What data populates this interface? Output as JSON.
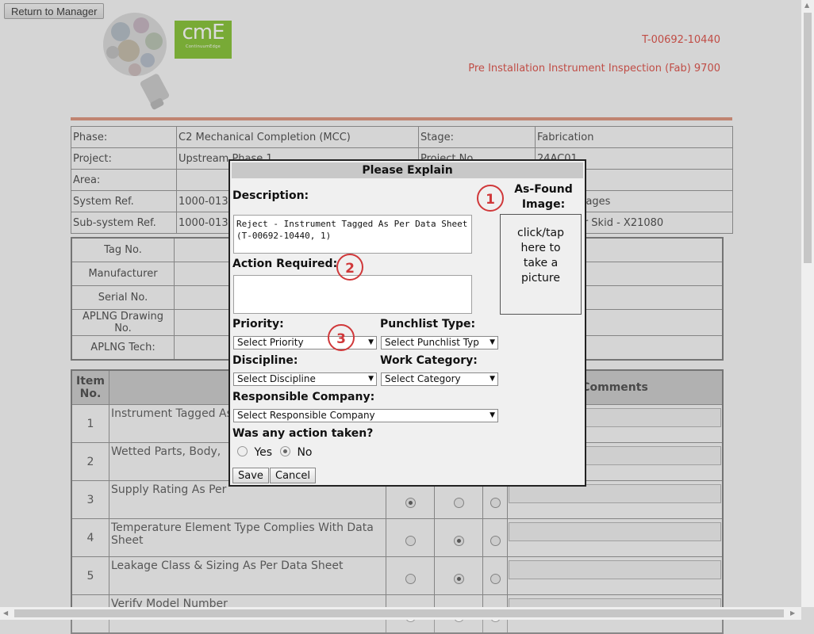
{
  "header": {
    "return_button": "Return to Manager",
    "logo_main": "cmE",
    "logo_sub": "ContinuumEdge",
    "doc_number": "T-00692-10440",
    "doc_title": "Pre Installation Instrument Inspection (Fab) 9700"
  },
  "info": {
    "rows": [
      {
        "l1": "Phase:",
        "v1": "C2 Mechanical Completion (MCC)",
        "l2": "Stage:",
        "v2": "Fabrication"
      },
      {
        "l1": "Project:",
        "v1": "Upstream Phase 1",
        "l2": "Project No.",
        "v2": "24AC01"
      },
      {
        "l1": "Area:",
        "v1": "",
        "l2": "",
        "v2": ""
      },
      {
        "l1": "System Ref.",
        "v1": "1000-013",
        "l2": "",
        "v2": "Skid Packages"
      },
      {
        "l1": "Sub-system Ref.",
        "v1": "1000-013-",
        "l2": "",
        "v2": "Separator Skid - X21080"
      }
    ]
  },
  "details": {
    "labels": [
      "Tag No.",
      "Manufacturer",
      "Serial No.",
      "APLNG Drawing No.",
      "APLNG Tech:"
    ]
  },
  "steps": {
    "headers": {
      "item": "Item No.",
      "step": "Ste",
      "comments": "Comments"
    },
    "rows": [
      {
        "num": "1",
        "text": "Instrument Tagged As"
      },
      {
        "num": "2",
        "text": "Wetted Parts, Body,"
      },
      {
        "num": "3",
        "text": "Supply Rating As Per"
      },
      {
        "num": "4",
        "text": "Temperature Element Type Complies With Data Sheet"
      },
      {
        "num": "5",
        "text": "Leakage Class & Sizing As Per Data Sheet"
      },
      {
        "num": "6",
        "text": "Verify Model Number"
      }
    ]
  },
  "modal": {
    "title": "Please Explain",
    "description_label": "Description:",
    "description_value": "Reject - Instrument Tagged As Per Data Sheet (T-00692-10440, 1)",
    "action_label": "Action Required:",
    "action_value": "",
    "image_label": "As-Found Image:",
    "image_hint": "click/tap here to take a picture",
    "priority_label": "Priority:",
    "priority_value": "Select Priority",
    "punchlist_label": "Punchlist Type:",
    "punchlist_value": "Select Punchlist Typ",
    "discipline_label": "Discipline:",
    "discipline_value": "Select Discipline",
    "work_category_label": "Work Category:",
    "work_category_value": "Select Category",
    "company_label": "Responsible Company:",
    "company_value": "Select Responsible Company",
    "action_taken_label": "Was any action taken?",
    "yes_label": "Yes",
    "no_label": "No",
    "action_taken_selected": "No",
    "save_label": "Save",
    "cancel_label": "Cancel"
  },
  "callouts": [
    "1",
    "2",
    "3"
  ],
  "colors": {
    "accent_red": "#e05a52",
    "logo_green": "#8cc63f",
    "callout_red": "#d0383a"
  }
}
